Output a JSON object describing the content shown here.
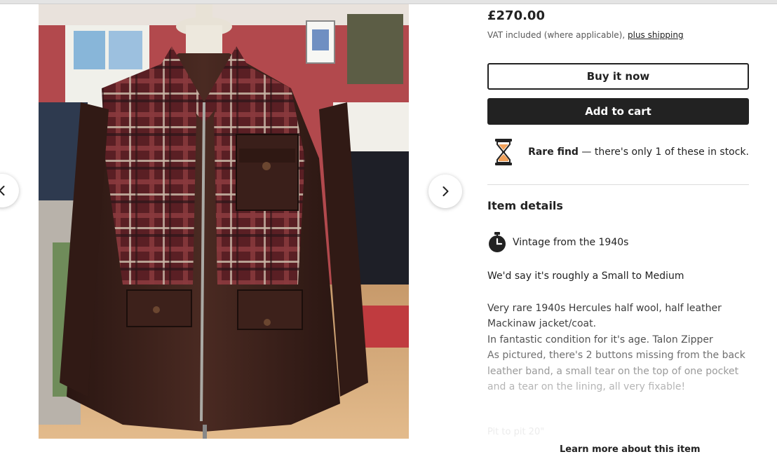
{
  "listing": {
    "price": "£270.00",
    "vat_text": "VAT included (where applicable),",
    "shipping_link": "plus shipping",
    "buy_now_label": "Buy it now",
    "add_to_cart_label": "Add to cart",
    "rare_find_title": "Rare find",
    "rare_find_text": " — there's only 1 of these in stock."
  },
  "item_details": {
    "title": "Item details",
    "vintage_label": "Vintage from the 1940s",
    "size_note": "We'd say it's roughly a Small to Medium",
    "description_lines": [
      "Very rare 1940s Hercules half wool, half leather",
      "Mackinaw jacket/coat.",
      "In fantastic condition for it's age. Talon Zipper",
      "As pictured, there's 2 buttons missing from the back",
      "leather band, a small tear on the top of one pocket",
      "and a tear on the lining, all very fixable!"
    ],
    "faded_line": "Pit to pit 20\"",
    "learn_more_label": "Learn more about this item"
  },
  "gallery": {
    "prev_icon": "chevron-left-icon",
    "next_icon": "chevron-right-icon",
    "image_subject": "jacket-photo"
  },
  "colors": {
    "primary_dark": "#222222",
    "hourglass_sand": "#f1a15a",
    "muted_text": "#595959"
  }
}
